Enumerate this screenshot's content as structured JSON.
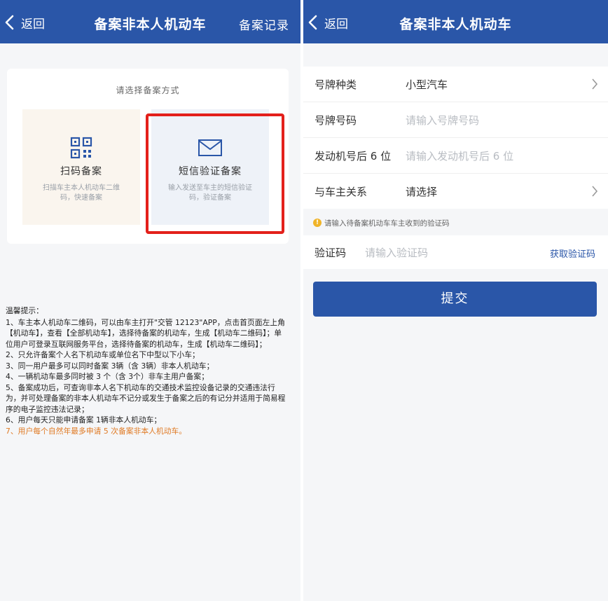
{
  "left": {
    "nav": {
      "back_label": "返回",
      "title": "备案非本人机动车",
      "right_action": "备案记录"
    },
    "choose_title": "请选择备案方式",
    "methods": [
      {
        "name": "扫码备案",
        "desc": "扫描车主本人机动车二维码，快速备案",
        "icon": "qr-code-icon"
      },
      {
        "name": "短信验证备案",
        "desc": "输入发送至车主的短信验证码，验证备案",
        "icon": "envelope-icon"
      }
    ],
    "tips": {
      "title": "温馨提示：",
      "items": [
        "1、车主本人机动车二维码，可以由车主打开\"交管 12123\"APP，点击首页面左上角【机动车】，查看【全部机动车】，选择待备案的机动车，生成【机动车二维码】；单位用户可登录互联网服务平台，选择待备案的机动车，生成【机动车二维码】；",
        "2、只允许备案个人名下机动车或单位名下中型以下小车；",
        "3、同一用户最多可以同时备案 3辆（含 3辆）非本人机动车；",
        "4、一辆机动车最多同时被 3 个（含 3个）非车主用户备案；",
        "5、备案成功后，可查询非本人名下机动车的交通技术监控设备记录的交通违法行为，并可处理备案的非本人机动车不记分或发生于备案之后的有记分并适用于简易程序的电子监控违法记录；",
        "6、用户每天只能申请备案 1辆非本人机动车；"
      ],
      "last_item": "7、用户每个自然年最多申请 5 次备案非本人机动车。"
    }
  },
  "right": {
    "nav": {
      "back_label": "返回",
      "title": "备案非本人机动车"
    },
    "fields": [
      {
        "label": "号牌种类",
        "value": "小型汽车",
        "placeholder": "",
        "has_arrow": true
      },
      {
        "label": "号牌号码",
        "value": "",
        "placeholder": "请输入号牌号码",
        "has_arrow": false
      },
      {
        "label": "发动机号后 6 位",
        "value": "",
        "placeholder": "请输入发动机号后 6 位",
        "has_arrow": false
      },
      {
        "label": "与车主关系",
        "value": "请选择",
        "placeholder": "",
        "has_arrow": true
      }
    ],
    "notice": "请输入待备案机动车车主收到的验证码",
    "verify": {
      "label": "验证码",
      "placeholder": "请输入验证码",
      "get_code": "获取验证码"
    },
    "submit_label": "提交"
  },
  "colors": {
    "nav_bg": "#2a56a8",
    "highlight": "#e3201b",
    "tip_orange": "#e07a24"
  }
}
